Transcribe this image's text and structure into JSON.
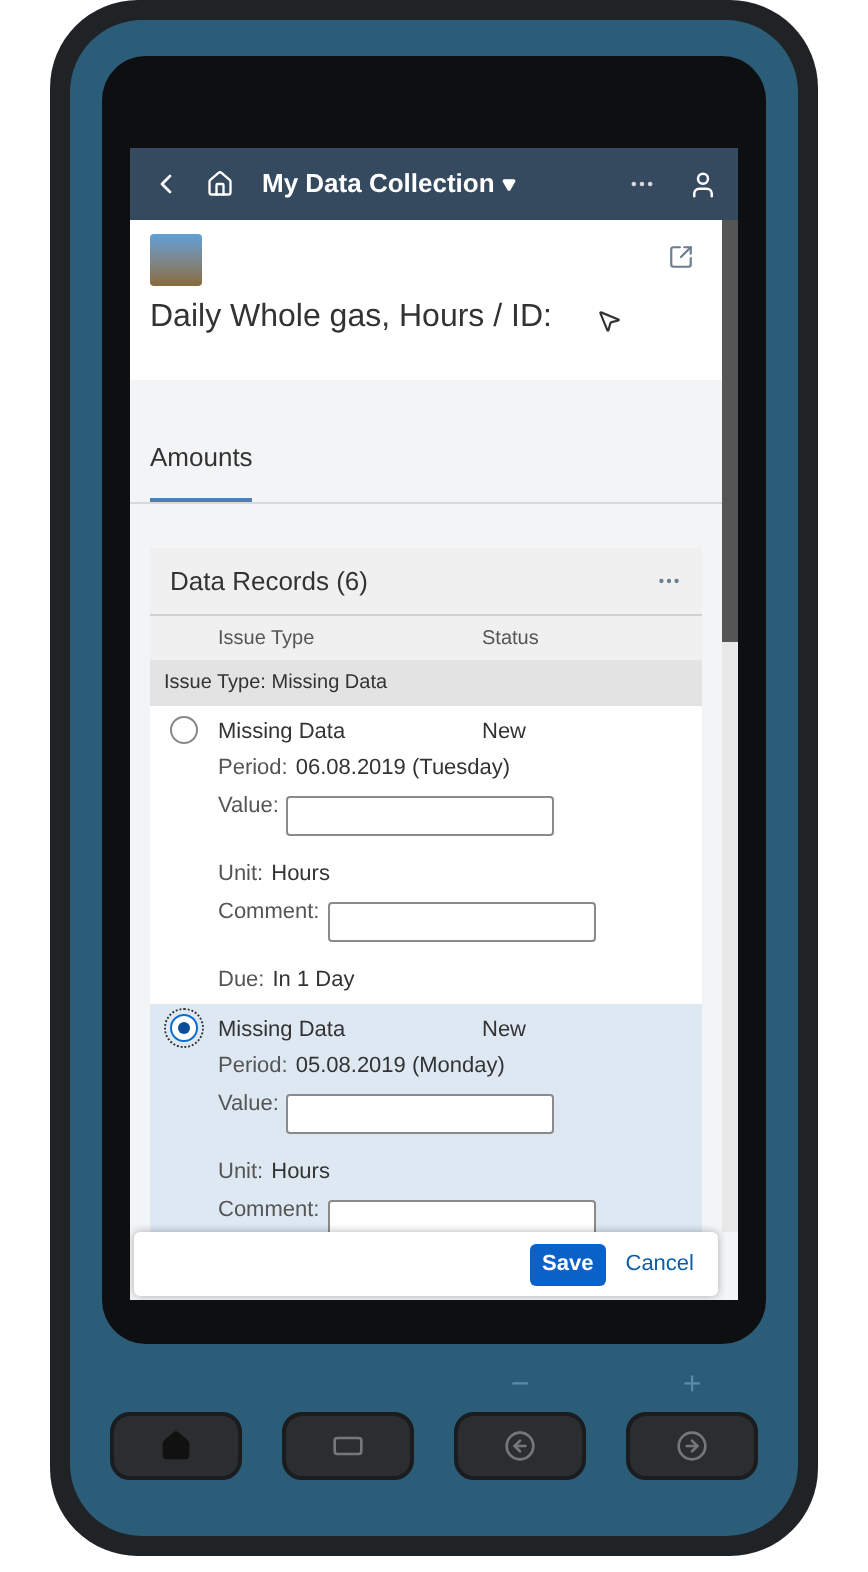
{
  "nav": {
    "title": "My Data Collection"
  },
  "object": {
    "title": "Daily Whole gas, Hours / ID:"
  },
  "tabs": [
    {
      "label": "Amounts",
      "selected": true
    }
  ],
  "table": {
    "title": "Data Records (6)",
    "columns": [
      "Issue Type",
      "Status"
    ],
    "group": "Issue Type: Missing Data",
    "rows": [
      {
        "selected": false,
        "issue": "Missing Data",
        "status": "New",
        "fields": [
          {
            "kind": "text",
            "label": "Period:",
            "value": "06.08.2019 (Tuesday)"
          },
          {
            "kind": "input",
            "label": "Value:"
          },
          {
            "kind": "text",
            "label": "Unit:",
            "value": "Hours"
          },
          {
            "kind": "input",
            "label": "Comment:"
          },
          {
            "kind": "text",
            "label": "Due:",
            "value": "In 1 Day"
          }
        ]
      },
      {
        "selected": true,
        "issue": "Missing Data",
        "status": "New",
        "fields": [
          {
            "kind": "text",
            "label": "Period:",
            "value": "05.08.2019 (Monday)"
          },
          {
            "kind": "input",
            "label": "Value:"
          },
          {
            "kind": "text",
            "label": "Unit:",
            "value": "Hours"
          },
          {
            "kind": "input",
            "label": "Comment:"
          }
        ]
      }
    ]
  },
  "footer": {
    "buttons": [
      {
        "label": "Save",
        "kind": "primary"
      },
      {
        "label": "Cancel",
        "kind": "plain"
      }
    ]
  },
  "hardware_keys": [
    {
      "kind": "home"
    },
    {
      "kind": "menu"
    },
    {
      "kind": "back",
      "caption": "−"
    },
    {
      "kind": "forward",
      "caption": "+"
    }
  ]
}
